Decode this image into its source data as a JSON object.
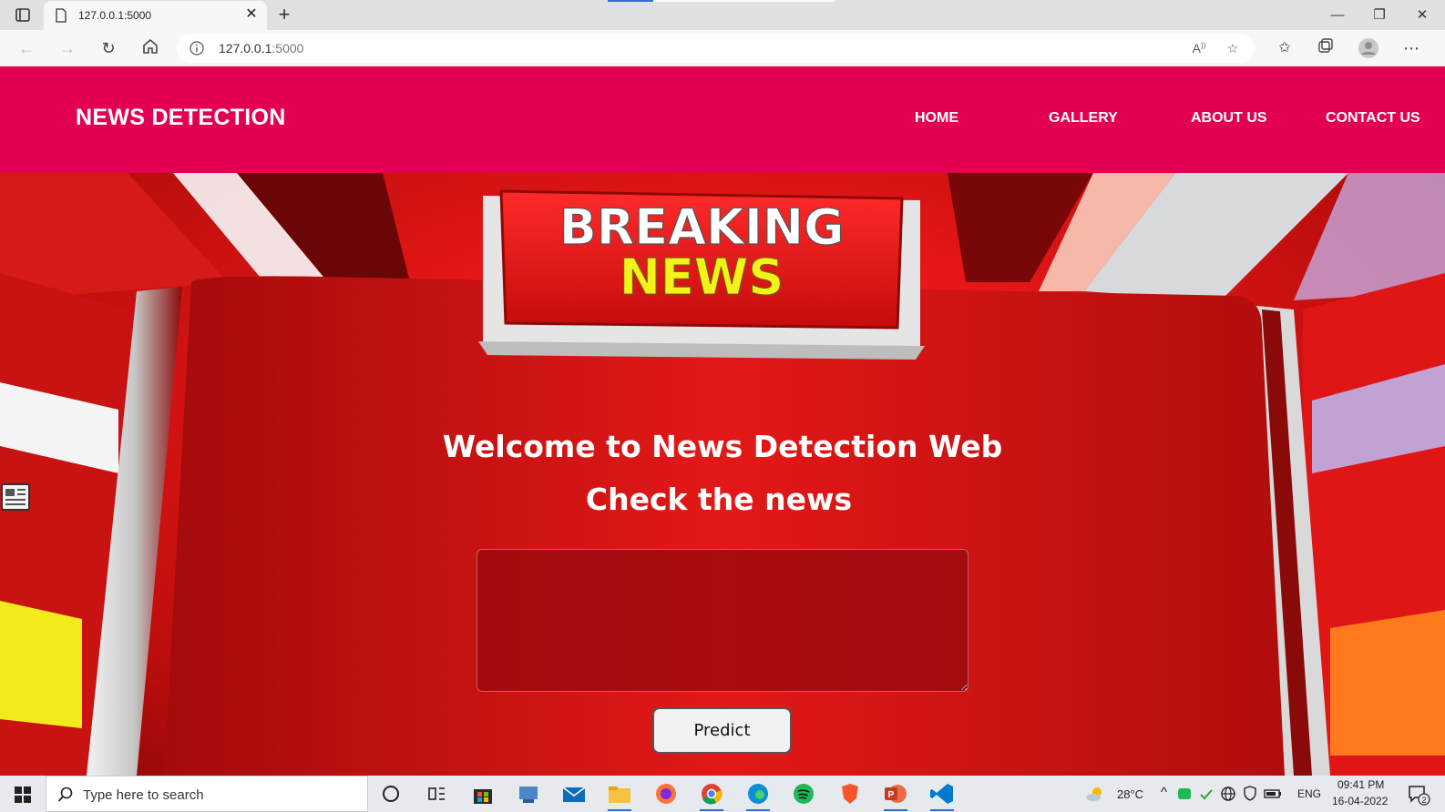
{
  "browser": {
    "tab_title": "127.0.0.1:5000",
    "url_host": "127.0.0.1",
    "url_port": ":5000"
  },
  "site": {
    "brand": "NEWS DETECTION",
    "nav": [
      "HOME",
      "GALLERY",
      "ABOUT US",
      "CONTACT US"
    ]
  },
  "hero": {
    "sign_line1": "BREAKING",
    "sign_line2": "NEWS",
    "welcome": "Welcome to News Detection Web",
    "check": "Check the news",
    "input_value": "",
    "predict_label": "Predict"
  },
  "taskbar": {
    "search_placeholder": "Type here to search",
    "weather": "28°C",
    "language": "ENG",
    "time": "09:41 PM",
    "date": "16-04-2022",
    "notifications": "2"
  },
  "colors": {
    "navbar": "#e30052",
    "hero_red": "#e71616",
    "sign_yellow": "#f4f21c"
  },
  "icons": [
    "tab-actions-icon",
    "page-icon",
    "close-icon",
    "plus-icon",
    "minimize-icon",
    "restore-icon",
    "window-close-icon",
    "back-icon",
    "forward-icon",
    "refresh-icon",
    "home-icon",
    "info-icon",
    "read-aloud-icon",
    "add-favorite-icon",
    "favorites-icon",
    "collections-icon",
    "profile-icon",
    "more-icon",
    "newspaper-icon",
    "windows-start-icon",
    "search-icon",
    "cortana-icon",
    "task-view-icon",
    "store-icon",
    "mail-icon",
    "file-explorer-icon",
    "firefox-icon",
    "chrome-icon",
    "edge-icon",
    "spotify-icon",
    "brave-icon",
    "powerpoint-icon",
    "vscode-icon",
    "weather-icon",
    "chevron-up-icon",
    "wifi-icon",
    "battery-icon",
    "notification-icon"
  ]
}
